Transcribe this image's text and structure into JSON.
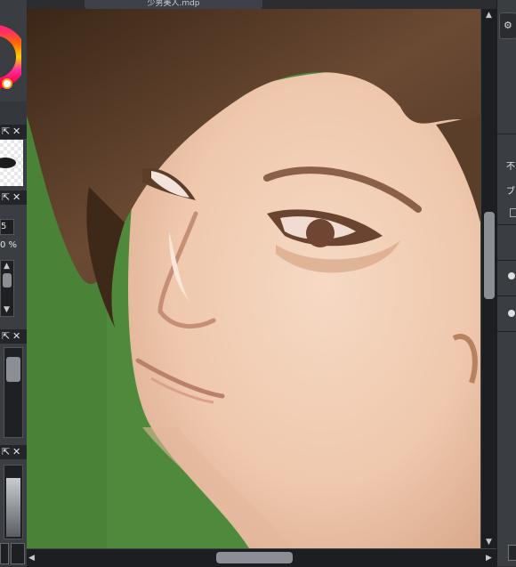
{
  "document_tab": {
    "title": "少男美人.mdp"
  },
  "left_dock": {
    "brush_size_value": "5",
    "opacity_value": "0 %",
    "panel_icons": [
      "popout-icon",
      "close-icon"
    ]
  },
  "right_dock": {
    "label_1": "不",
    "label_2": "ブ"
  },
  "colors": {
    "canvas_background": "#4f8a3c",
    "ui_dark": "#2b2d30",
    "scroll_thumb": "#8b8f95"
  }
}
